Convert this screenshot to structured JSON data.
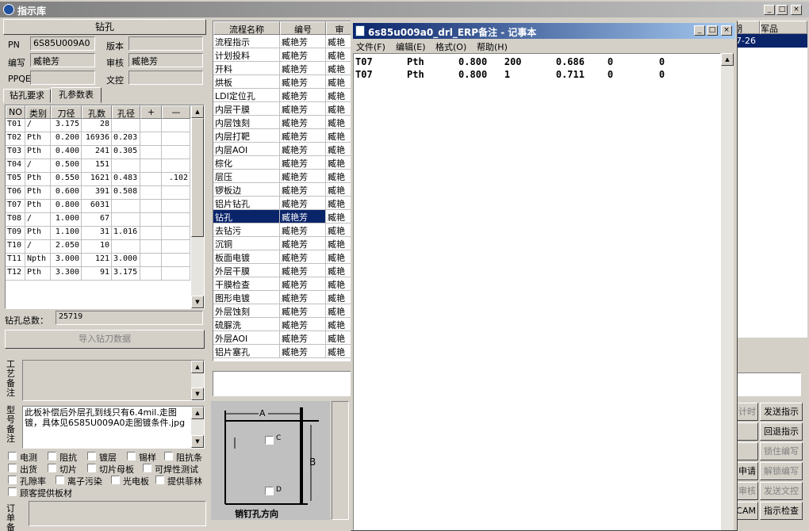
{
  "window": {
    "title": "指示库"
  },
  "drill": {
    "section_title": "钻孔",
    "pn_label": "PN",
    "pn_value": "6S85U009A0",
    "version_label": "版本",
    "version_value": "",
    "writer_label": "编写",
    "writer_value": "臧艳芳",
    "reviewer_label": "审核",
    "reviewer_value": "臧艳芳",
    "ppqe_label": "PPQE",
    "ppqe_value": "",
    "doc_label": "文控",
    "doc_value": "",
    "tabs": [
      "钻孔要求",
      "孔参数表"
    ],
    "columns": [
      "NO",
      "类别",
      "刀径",
      "孔数",
      "孔径",
      "+",
      "—"
    ],
    "rows": [
      [
        "T01",
        "/",
        "3.175",
        "28",
        "",
        "",
        ""
      ],
      [
        "T02",
        "Pth",
        "0.200",
        "16936",
        "0.203",
        "",
        ""
      ],
      [
        "T03",
        "Pth",
        "0.400",
        "241",
        "0.305",
        "",
        ""
      ],
      [
        "T04",
        "/",
        "0.500",
        "151",
        "",
        "",
        ""
      ],
      [
        "T05",
        "Pth",
        "0.550",
        "1621",
        "0.483",
        "",
        ".102"
      ],
      [
        "T06",
        "Pth",
        "0.600",
        "391",
        "0.508",
        "",
        ""
      ],
      [
        "T07",
        "Pth",
        "0.800",
        "6031",
        "",
        "",
        ""
      ],
      [
        "T08",
        "/",
        "1.000",
        "67",
        "",
        "",
        ""
      ],
      [
        "T09",
        "Pth",
        "1.100",
        "31",
        "1.016",
        "",
        ""
      ],
      [
        "T10",
        "/",
        "2.050",
        "10",
        "",
        "",
        ""
      ],
      [
        "T11",
        "Npth",
        "3.000",
        "121",
        "3.000",
        "",
        ""
      ],
      [
        "T12",
        "Pth",
        "3.300",
        "91",
        "3.175",
        "",
        ""
      ]
    ],
    "total_label": "钻孔总数：",
    "total_value": "25719",
    "import_button": "导入钻刀数据"
  },
  "notes": {
    "process_label": "工艺备注",
    "process_value": "",
    "type_label": "型号备注",
    "type_value": "此板补偿后外层孔到线只有6.4mil.走图镀，具体见6S85U009A0走图镀条件.jpg",
    "order_label": "订单备注",
    "order_value": ""
  },
  "checkboxes": [
    [
      "电测",
      "阻抗",
      "镀层",
      "锡样",
      "阻抗条"
    ],
    [
      "出货",
      "切片",
      "切片母板",
      "可焊性测试"
    ],
    [
      "孔隙率",
      "离子污染",
      "光电板",
      "提供菲林"
    ],
    [
      "顾客提供板材"
    ]
  ],
  "flow": {
    "columns": [
      "流程名称",
      "编号",
      "审"
    ],
    "rows": [
      [
        "流程指示",
        "臧艳芳",
        "臧艳"
      ],
      [
        "计划投料",
        "臧艳芳",
        "臧艳"
      ],
      [
        "开料",
        "臧艳芳",
        "臧艳"
      ],
      [
        "烘板",
        "臧艳芳",
        "臧艳"
      ],
      [
        "LDI定位孔",
        "臧艳芳",
        "臧艳"
      ],
      [
        "内层干膜",
        "臧艳芳",
        "臧艳"
      ],
      [
        "内层蚀刻",
        "臧艳芳",
        "臧艳"
      ],
      [
        "内层打靶",
        "臧艳芳",
        "臧艳"
      ],
      [
        "内层AOI",
        "臧艳芳",
        "臧艳"
      ],
      [
        "棕化",
        "臧艳芳",
        "臧艳"
      ],
      [
        "层压",
        "臧艳芳",
        "臧艳"
      ],
      [
        "锣板边",
        "臧艳芳",
        "臧艳"
      ],
      [
        "铝片钻孔",
        "臧艳芳",
        "臧艳"
      ],
      [
        "钻孔",
        "臧艳芳",
        "臧艳"
      ],
      [
        "去钻污",
        "臧艳芳",
        "臧艳"
      ],
      [
        "沉铜",
        "臧艳芳",
        "臧艳"
      ],
      [
        "板面电镀",
        "臧艳芳",
        "臧艳"
      ],
      [
        "外层干膜",
        "臧艳芳",
        "臧艳"
      ],
      [
        "干膜检查",
        "臧艳芳",
        "臧艳"
      ],
      [
        "图形电镀",
        "臧艳芳",
        "臧艳"
      ],
      [
        "外层蚀刻",
        "臧艳芳",
        "臧艳"
      ],
      [
        "硫脲洗",
        "臧艳芳",
        "臧艳"
      ],
      [
        "外层AOI",
        "臧艳芳",
        "臧艳"
      ],
      [
        "铝片塞孔",
        "臧艳芳",
        "臧艳"
      ]
    ],
    "selected_index": 13
  },
  "pin_diagram": {
    "label_a": "A",
    "label_b": "B",
    "label_c": "C",
    "label_d": "D",
    "caption": "销钉孔方向"
  },
  "right_table": {
    "columns": [
      "期",
      "军品"
    ],
    "selected_row": [
      "7-26",
      ""
    ]
  },
  "right_buttons": [
    [
      "计时",
      "发送指示"
    ],
    [
      "",
      "回退指示"
    ],
    [
      "",
      "锁住编写"
    ],
    [
      "申请",
      "解锁编写"
    ],
    [
      "审核",
      "发送文控"
    ],
    [
      "CAM",
      "指示检查"
    ]
  ],
  "notepad": {
    "title": "6s85u009a0_drl_ERP备注 - 记事本",
    "menu": [
      "文件(F)",
      "编辑(E)",
      "格式(O)",
      "帮助(H)"
    ],
    "lines": [
      "T07      Pth      0.800   200      0.686    0        0",
      "T07      Pth      0.800   1        0.711    0        0"
    ]
  },
  "colors": {
    "selection": "#0a246a",
    "titlebar": "#0a246a",
    "face": "#d4d0c8"
  }
}
